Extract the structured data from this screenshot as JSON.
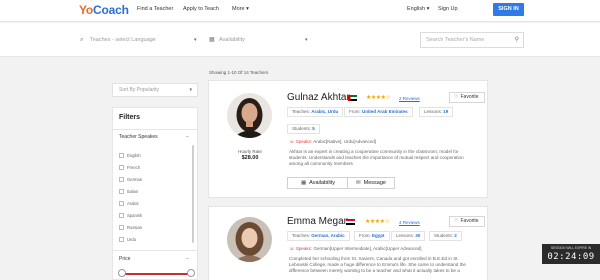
{
  "brand": {
    "yo": "Yo",
    "coach": "Coach"
  },
  "nav": {
    "links": [
      "Find a Teacher",
      "Apply to Teach",
      "More"
    ],
    "more_caret": "▾",
    "language": "English",
    "sign_up": "Sign Up",
    "sign_in": "SIGN IN"
  },
  "search": {
    "language_placeholder": "Teaches - select Language",
    "availability_placeholder": "Availability",
    "name_placeholder": "Search Teacher's Name"
  },
  "results": {
    "showing": "Showing 1-10 Of 14 Teachers"
  },
  "sidebar": {
    "sort_label": "Sort By Popularity",
    "filters_title": "Filters",
    "teacher_speaks": "Teacher Speakes",
    "languages": [
      "English",
      "French",
      "German",
      "Italian",
      "Arabic",
      "Spanish",
      "Russian",
      "Urdu"
    ],
    "price_label": "Price",
    "collapse": "−",
    "expand": "+"
  },
  "teachers": [
    {
      "name": "Gulnaz Akhtar",
      "stars": "★★★★☆",
      "reviews": "2 Reviews",
      "favorite": "Favorite",
      "teaches_label": "Teaches:",
      "teaches": "Arabic, Urdu",
      "from_label": "From:",
      "from": "United Arab Emirates",
      "lessons_label": "Lessons:",
      "lessons": "19",
      "students_label": "Students:",
      "students": "5",
      "speaks_label": "Speaks:",
      "speaks": "Arabic[Native], Urdu[Advanced]",
      "description": "Akhtar is an expert in creating a cooperative community in the classroom; model for students. Understands and teaches the importance of mutual respect and cooperation among all community members",
      "hourly_label": "Hourly Rate",
      "hourly": "$28.00",
      "availability_btn": "Availability",
      "message_btn": "Message"
    },
    {
      "name": "Emma Megan",
      "stars": "★★★★☆",
      "reviews": "4 Reviews",
      "favorite": "Favorite",
      "teaches_label": "Teaches:",
      "teaches": "German, Arabic",
      "from_label": "From:",
      "from": "Egypt",
      "lessons_label": "Lessons:",
      "lessons": "30",
      "students_label": "Students:",
      "students": "2",
      "speaks_label": "Speaks:",
      "speaks": "German[Upper Intermediate], Arabic[Upper Advanced]",
      "description": "Completed her schooling from St. Xaviers, Canada and got enrolled in B.E.Ed in St. Lebowski College, made a huge difference to Emma's life. She came to understand the difference between merely wanting to be a teacher and what it actually takes to be a"
    }
  ],
  "timer": {
    "caption": "SESSION WILL EXPIRE IN",
    "value": "02:24:09"
  },
  "colors": {
    "accent": "#2f7be5",
    "brand_orange": "#f2662b",
    "star": "#f0a500",
    "speaks": "#d64541"
  }
}
